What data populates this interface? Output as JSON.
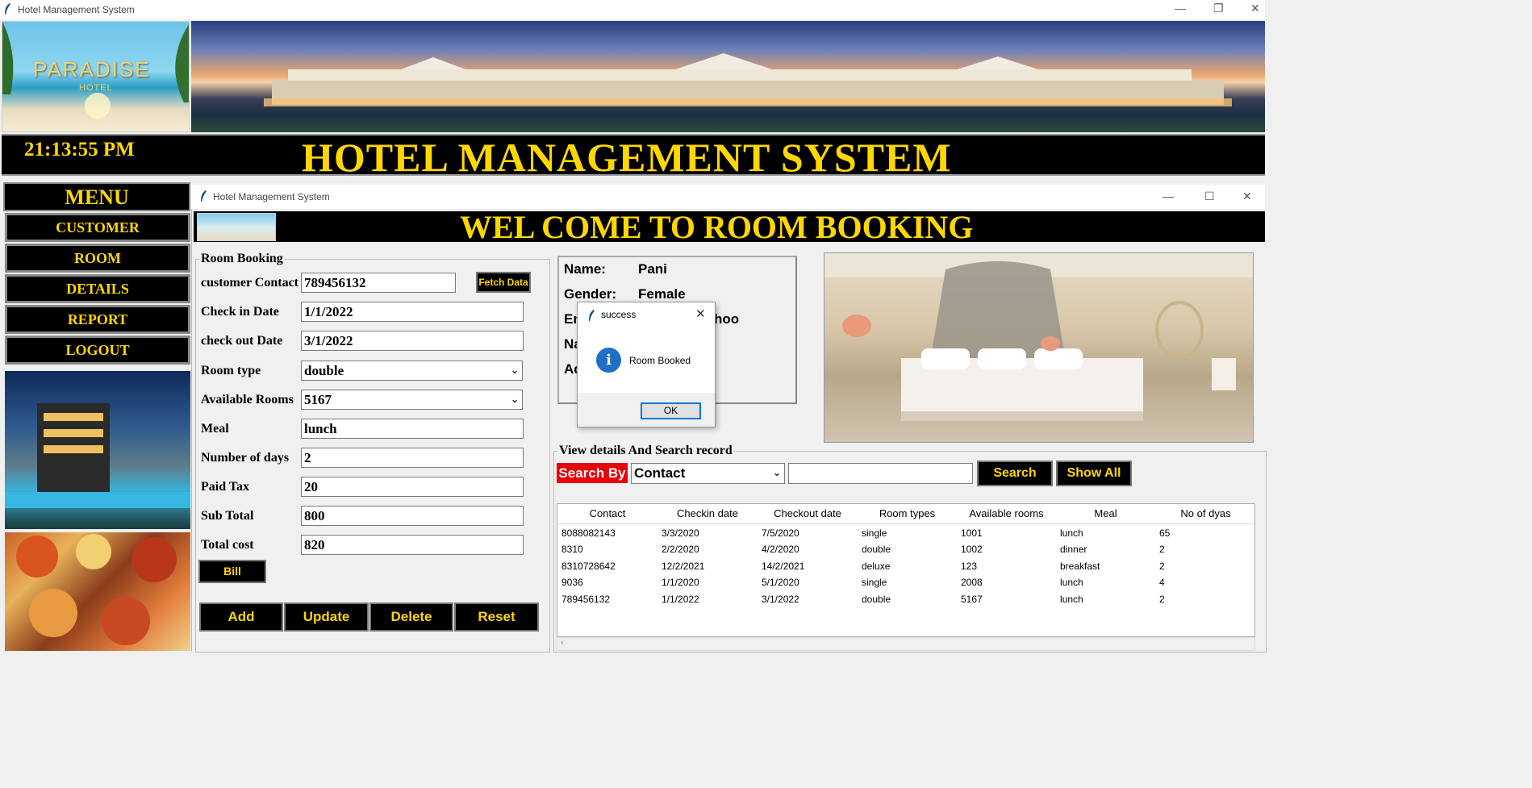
{
  "main_window": {
    "title": "Hotel Management System",
    "minimize": "—",
    "restore": "❐",
    "close": "✕"
  },
  "logo": {
    "brand": "PARADISE",
    "sub": "HOTEL"
  },
  "header": {
    "clock": "21:13:55 PM",
    "title": "HOTEL MANAGEMENT SYSTEM"
  },
  "menu": {
    "title": "MENU",
    "items": [
      {
        "label": "CUSTOMER"
      },
      {
        "label": "ROOM"
      },
      {
        "label": "DETAILS"
      },
      {
        "label": "REPORT"
      },
      {
        "label": "LOGOUT"
      }
    ]
  },
  "booking_window": {
    "title": "Hotel Management System",
    "minimize": "—",
    "maximize": "☐",
    "close": "✕",
    "banner": "WEL COME TO ROOM BOOKING"
  },
  "room_booking": {
    "legend": "Room Booking",
    "fields": {
      "contact": {
        "label": "customer Contact",
        "value": "789456132"
      },
      "checkin": {
        "label": "Check in Date",
        "value": "1/1/2022"
      },
      "checkout": {
        "label": "check out Date",
        "value": "3/1/2022"
      },
      "room_type": {
        "label": "Room type",
        "value": "double"
      },
      "available": {
        "label": "Available Rooms",
        "value": "5167"
      },
      "meal": {
        "label": "Meal",
        "value": "lunch"
      },
      "days": {
        "label": "Number of days",
        "value": "2"
      },
      "tax": {
        "label": "Paid Tax",
        "value": "20"
      },
      "subtotal": {
        "label": "Sub Total",
        "value": "800"
      },
      "total": {
        "label": "Total cost",
        "value": "820"
      }
    },
    "fetch_button": "Fetch Data",
    "bill_button": "Bill",
    "buttons": {
      "add": "Add",
      "update": "Update",
      "delete": "Delete",
      "reset": "Reset"
    }
  },
  "customer_info": {
    "name_label": "Name:",
    "name_value": "Pani",
    "gender_label": "Gender:",
    "gender_value": "Female",
    "email_label_partial": "En",
    "email_value_partial": "hoo",
    "nationality_label_partial": "Na",
    "address_label_partial": "Ad"
  },
  "search": {
    "legend": "View details And Search record",
    "search_by_label": "Search By",
    "search_by_value": "Contact",
    "search_text": "",
    "search_button": "Search",
    "show_all_button": "Show All"
  },
  "table": {
    "columns": [
      "Contact",
      "Checkin date",
      "Checkout date",
      "Room types",
      "Available rooms",
      "Meal",
      "No of dyas"
    ],
    "rows": [
      [
        "8088082143",
        "3/3/2020",
        "7/5/2020",
        "single",
        "1001",
        "lunch",
        "65"
      ],
      [
        "8310",
        "2/2/2020",
        "4/2/2020",
        "double",
        "1002",
        "dinner",
        "2"
      ],
      [
        "8310728642",
        "12/2/2021",
        "14/2/2021",
        "deluxe",
        "123",
        "breakfast",
        "2"
      ],
      [
        "9036",
        "1/1/2020",
        "5/1/2020",
        "single",
        "2008",
        "lunch",
        "4"
      ],
      [
        "789456132",
        "1/1/2022",
        "3/1/2022",
        "double",
        "5167",
        "lunch",
        "2"
      ]
    ]
  },
  "dialog": {
    "title": "success",
    "message": "Room Booked",
    "ok": "OK",
    "close": "✕",
    "icon_glyph": "i"
  }
}
